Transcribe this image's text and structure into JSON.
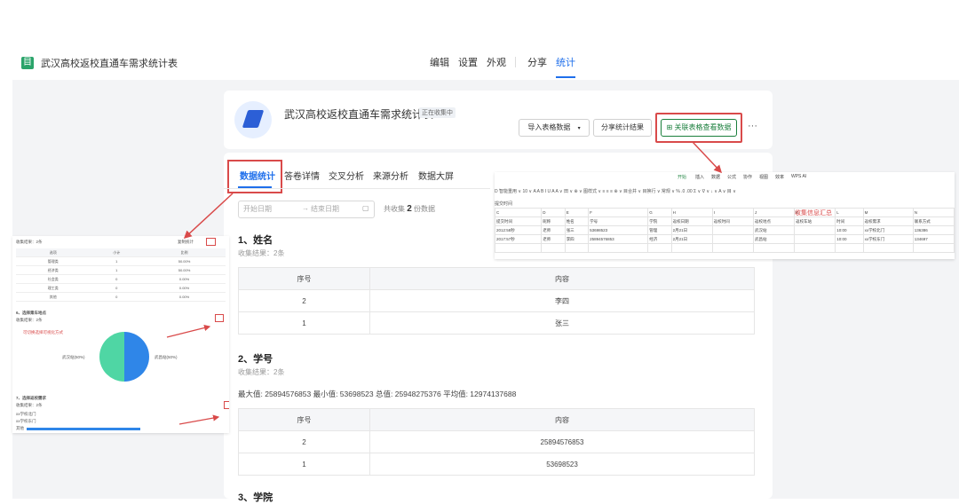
{
  "app": {
    "title": "武汉高校返校直通车需求统计表",
    "icon": "form-icon"
  },
  "nav": {
    "items": [
      "编辑",
      "设置",
      "外观",
      "分享",
      "统计"
    ],
    "active": "统计"
  },
  "form": {
    "title": "武汉高校返校直通车需求统计表",
    "status": "正在收集中"
  },
  "actions": {
    "import": "导入表格数据",
    "share_stats": "分享统计结果",
    "link_sheet": "关联表格查看数据",
    "more": "···"
  },
  "tabs": [
    "数据统计",
    "答卷详情",
    "交叉分析",
    "来源分析",
    "数据大屏"
  ],
  "filter": {
    "start_placeholder": "开始日期",
    "arrow": "→",
    "end_placeholder": "结束日期",
    "collected_prefix": "共收集",
    "collected_count": "2",
    "collected_suffix": "份数据"
  },
  "section1": {
    "title": "1、姓名",
    "sub": "收集结果：2条",
    "headers": [
      "序号",
      "内容"
    ],
    "rows": [
      [
        "2",
        "李四"
      ],
      [
        "1",
        "张三"
      ]
    ]
  },
  "section2": {
    "title": "2、学号",
    "sub": "收集结果：2条",
    "stats": "最大值: 25894576853    最小值: 53698523    总值: 25948275376    平均值: 12974137688",
    "headers": [
      "序号",
      "内容"
    ],
    "rows": [
      [
        "2",
        "25894576853"
      ],
      [
        "1",
        "53698523"
      ]
    ]
  },
  "section3": {
    "title": "3、学院"
  },
  "sheet": {
    "menu": [
      "开始",
      "插入",
      "数据",
      "公式",
      "协作",
      "视图",
      "效率",
      "WPS AI"
    ],
    "toolbar": "D  智能重用 ∨  10 ∨  A  A  B  I  U  A  A ∨  田 ∨  ⊕ ∨  图样式 ∨  ≡  ≡  ≡  ⊕ ∨  目合并 ∨  目换行 ∨  常规  ∨  %  .0  .00  Σ ∨  ∇ ∨  ↓ ∨  A ∨  目 ∨",
    "name_box": "提交时间",
    "note": "收集信息汇总",
    "col_letters": [
      "C",
      "D",
      "E",
      "F",
      "G",
      "H",
      "I",
      "J",
      "K",
      "L",
      "M",
      "N"
    ],
    "header_row": [
      "提交时间",
      "昵称",
      "姓名",
      "学号",
      "学院",
      "返校日期",
      "返校时间",
      "返校地点",
      "返校车站",
      "时间",
      "返校需求",
      "联系方式"
    ],
    "rows": [
      [
        "2012:58秒",
        "老师",
        "张三",
        "53698523",
        "管理",
        "2月21日",
        "",
        "武汉站",
        "",
        "10:00",
        "xx学校北门",
        "136386"
      ],
      [
        "2017:57秒",
        "老师",
        "李四",
        "25894576853",
        "经济",
        "2月21日",
        "",
        "武昌站",
        "",
        "10:00",
        "xx学校东门",
        "134697"
      ]
    ]
  },
  "preview": {
    "header_left": "收集结果：2条",
    "header_mid": "复制统计",
    "table_headers": [
      "选项",
      "小计",
      "比例"
    ],
    "table_rows": [
      [
        "管理类",
        "1",
        "50.00%"
      ],
      [
        "经济类",
        "1",
        "50.00%"
      ],
      [
        "社会类",
        "0",
        "0.00%"
      ],
      [
        "理工类",
        "0",
        "0.00%"
      ],
      [
        "其他",
        "0",
        "0.00%"
      ]
    ],
    "q6_title": "6、选择乘车地点",
    "q6_sub": "收集结果：2条",
    "q6_note": "可切换选择可视化方式",
    "pie_left": "武汉站(50%)",
    "pie_right": "武昌站(50%)",
    "q7_title": "7、选择返校需求",
    "q7_sub": "收集结果：2条",
    "q7_items": [
      "xx学校北门",
      "xx学校东门",
      "其他"
    ]
  },
  "colors": {
    "accent": "#1f6feb",
    "highlight": "#d94a4a",
    "green": "#1a7f3c"
  }
}
